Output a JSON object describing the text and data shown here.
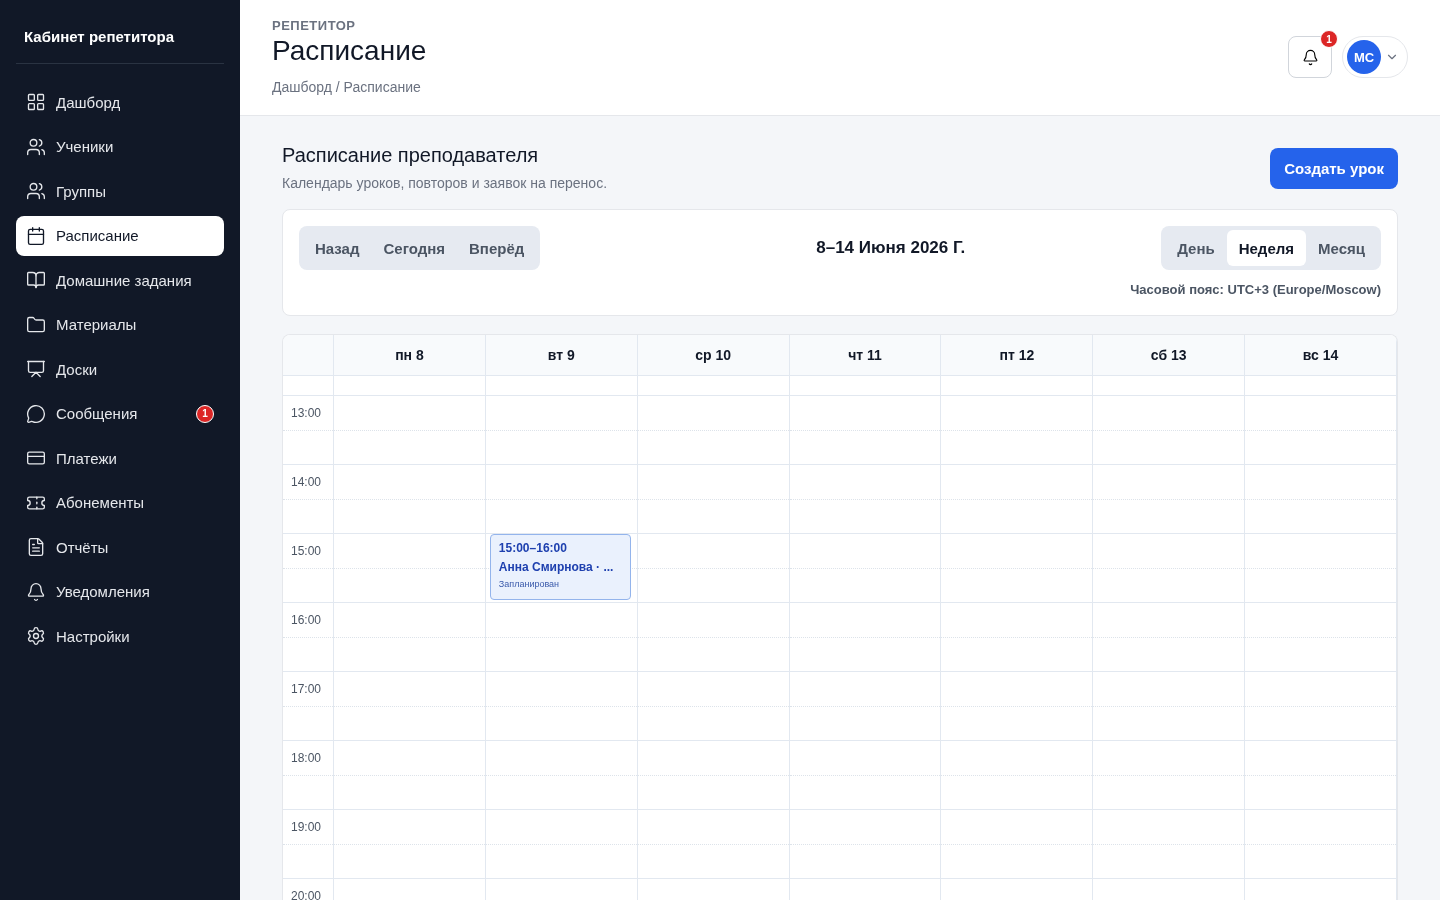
{
  "sidebar": {
    "title": "Кабинет репетитора",
    "items": [
      {
        "label": "Дашборд",
        "selected": false
      },
      {
        "label": "Ученики",
        "selected": false
      },
      {
        "label": "Группы",
        "selected": false
      },
      {
        "label": "Расписание",
        "selected": true
      },
      {
        "label": "Домашние задания",
        "selected": false
      },
      {
        "label": "Материалы",
        "selected": false
      },
      {
        "label": "Доски",
        "selected": false
      },
      {
        "label": "Сообщения",
        "selected": false,
        "badge": "1"
      },
      {
        "label": "Платежи",
        "selected": false
      },
      {
        "label": "Абонементы",
        "selected": false
      },
      {
        "label": "Отчёты",
        "selected": false
      },
      {
        "label": "Уведомления",
        "selected": false
      },
      {
        "label": "Настройки",
        "selected": false
      }
    ]
  },
  "header": {
    "eyebrow": "РЕПЕТИТОР",
    "title": "Расписание",
    "breadcrumb": "Дашборд / Расписание",
    "notification_count": "1",
    "avatar": "МС"
  },
  "section": {
    "title": "Расписание преподавателя",
    "subtitle": "Календарь уроков, повторов и заявок на перенос.",
    "create_button": "Создать урок"
  },
  "toolbar": {
    "nav": [
      "Назад",
      "Сегодня",
      "Вперёд"
    ],
    "range": "8–14 Июня 2026 Г.",
    "views": [
      {
        "label": "День",
        "selected": false
      },
      {
        "label": "Неделя",
        "selected": true
      },
      {
        "label": "Месяц",
        "selected": false
      }
    ],
    "timezone": "Часовой пояс: UTC+3 (Europe/Moscow)"
  },
  "calendar": {
    "days": [
      {
        "label": "пн 8"
      },
      {
        "label": "вт 9",
        "events": [
          {
            "time": "15:00–16:00",
            "title": "Анна Смирнова · ...",
            "status": "Запланирован"
          }
        ]
      },
      {
        "label": "ср 10"
      },
      {
        "label": "чт 11"
      },
      {
        "label": "пт 12"
      },
      {
        "label": "сб 13"
      },
      {
        "label": "вс 14"
      }
    ],
    "hours": [
      {
        "label": "13:00"
      },
      {
        "label": "14:00"
      },
      {
        "label": "15:00"
      },
      {
        "label": "16:00"
      },
      {
        "label": "17:00"
      },
      {
        "label": "18:00"
      },
      {
        "label": "19:00"
      },
      {
        "label": "20:00"
      }
    ]
  }
}
